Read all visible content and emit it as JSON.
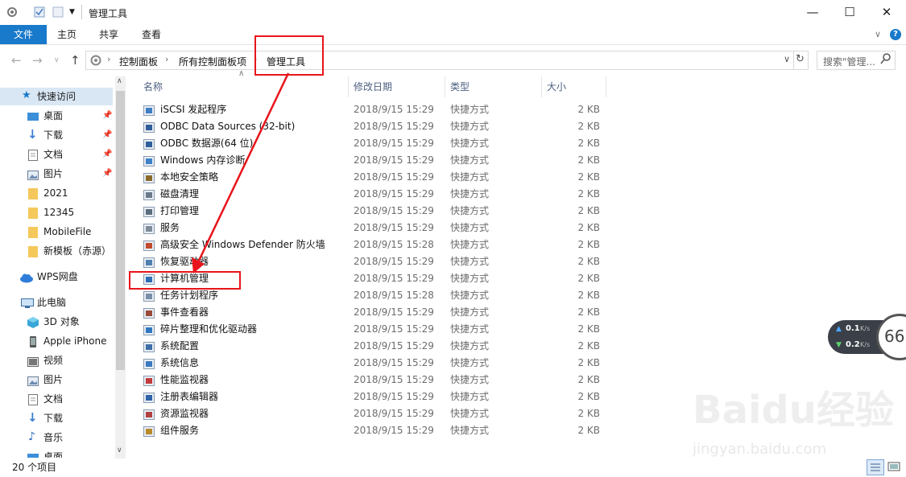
{
  "window": {
    "title": "管理工具",
    "min": "—",
    "max": "☐",
    "close": "✕"
  },
  "ribbon": {
    "tabs": [
      "文件",
      "主页",
      "共享",
      "查看"
    ]
  },
  "address": {
    "crumbs": [
      "控制面板",
      "所有控制面板项",
      "管理工具"
    ],
    "search_placeholder": "搜索\"管理..."
  },
  "sidebar": {
    "quick_access": "快速访问",
    "items": [
      "桌面",
      "下载",
      "文档",
      "图片",
      "2021",
      "12345",
      "MobileFile",
      "新模板（赤源）"
    ],
    "wps": "WPS网盘",
    "this_pc": "此电脑",
    "pc_items": [
      "3D 对象",
      "Apple iPhone",
      "视频",
      "图片",
      "文档",
      "下载",
      "音乐",
      "桌面"
    ]
  },
  "columns": {
    "name": "名称",
    "date": "修改日期",
    "type": "类型",
    "size": "大小"
  },
  "files": [
    {
      "name": "iSCSI 发起程序",
      "date": "2018/9/15 15:29",
      "type": "快捷方式",
      "size": "2 KB",
      "icon": "iscsi-icon"
    },
    {
      "name": "ODBC Data Sources (32-bit)",
      "date": "2018/9/15 15:29",
      "type": "快捷方式",
      "size": "2 KB",
      "icon": "odbc-icon"
    },
    {
      "name": "ODBC 数据源(64 位)",
      "date": "2018/9/15 15:29",
      "type": "快捷方式",
      "size": "2 KB",
      "icon": "odbc-icon"
    },
    {
      "name": "Windows 内存诊断",
      "date": "2018/9/15 15:29",
      "type": "快捷方式",
      "size": "2 KB",
      "icon": "memory-icon"
    },
    {
      "name": "本地安全策略",
      "date": "2018/9/15 15:29",
      "type": "快捷方式",
      "size": "2 KB",
      "icon": "policy-icon"
    },
    {
      "name": "磁盘清理",
      "date": "2018/9/15 15:29",
      "type": "快捷方式",
      "size": "2 KB",
      "icon": "disk-icon"
    },
    {
      "name": "打印管理",
      "date": "2018/9/15 15:29",
      "type": "快捷方式",
      "size": "2 KB",
      "icon": "printer-icon"
    },
    {
      "name": "服务",
      "date": "2018/9/15 15:29",
      "type": "快捷方式",
      "size": "2 KB",
      "icon": "services-icon"
    },
    {
      "name": "高级安全 Windows Defender 防火墙",
      "date": "2018/9/15 15:28",
      "type": "快捷方式",
      "size": "2 KB",
      "icon": "firewall-icon"
    },
    {
      "name": "恢复驱动器",
      "date": "2018/9/15 15:29",
      "type": "快捷方式",
      "size": "2 KB",
      "icon": "recovery-icon"
    },
    {
      "name": "计算机管理",
      "date": "2018/9/15 15:29",
      "type": "快捷方式",
      "size": "2 KB",
      "icon": "computer-mgmt-icon"
    },
    {
      "name": "任务计划程序",
      "date": "2018/9/15 15:28",
      "type": "快捷方式",
      "size": "2 KB",
      "icon": "task-icon"
    },
    {
      "name": "事件查看器",
      "date": "2018/9/15 15:29",
      "type": "快捷方式",
      "size": "2 KB",
      "icon": "event-icon"
    },
    {
      "name": "碎片整理和优化驱动器",
      "date": "2018/9/15 15:29",
      "type": "快捷方式",
      "size": "2 KB",
      "icon": "defrag-icon"
    },
    {
      "name": "系统配置",
      "date": "2018/9/15 15:29",
      "type": "快捷方式",
      "size": "2 KB",
      "icon": "sysconfig-icon"
    },
    {
      "name": "系统信息",
      "date": "2018/9/15 15:29",
      "type": "快捷方式",
      "size": "2 KB",
      "icon": "sysinfo-icon"
    },
    {
      "name": "性能监视器",
      "date": "2018/9/15 15:29",
      "type": "快捷方式",
      "size": "2 KB",
      "icon": "perf-icon"
    },
    {
      "name": "注册表编辑器",
      "date": "2018/9/15 15:29",
      "type": "快捷方式",
      "size": "2 KB",
      "icon": "registry-icon"
    },
    {
      "name": "资源监视器",
      "date": "2018/9/15 15:29",
      "type": "快捷方式",
      "size": "2 KB",
      "icon": "resmon-icon"
    },
    {
      "name": "组件服务",
      "date": "2018/9/15 15:29",
      "type": "快捷方式",
      "size": "2 KB",
      "icon": "component-icon"
    }
  ],
  "status": {
    "count": "20 个项目"
  },
  "speed": {
    "up": "0.1",
    "down": "0.2",
    "unit": "K/s",
    "score": "66"
  },
  "watermark": {
    "brand": "Baidu经验",
    "url": "jingyan.baidu.com"
  },
  "colors": {
    "accent": "#1979ca",
    "annotation": "#e8141b",
    "selected": "#d9e7f5"
  }
}
